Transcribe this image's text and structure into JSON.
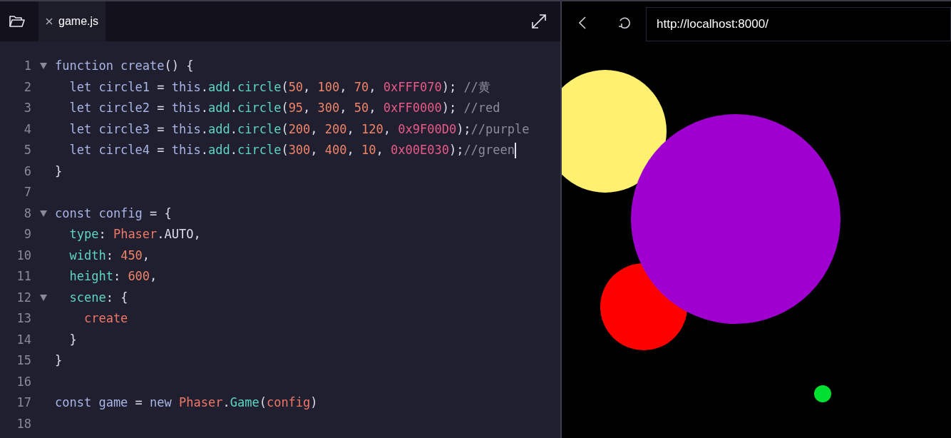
{
  "editor": {
    "tab": {
      "label": "game.js",
      "selected": true
    },
    "lines": [
      {
        "number": "1",
        "foldable": true,
        "cursor": false,
        "tokens": [
          {
            "kind": "keyword",
            "text": "function create"
          },
          {
            "kind": "plain",
            "text": "() {"
          }
        ]
      },
      {
        "number": "2",
        "foldable": false,
        "cursor": false,
        "tokens": [
          {
            "kind": "keyword",
            "text": "  let circle1 "
          },
          {
            "kind": "plain",
            "text": "= "
          },
          {
            "kind": "keyword",
            "text": "this"
          },
          {
            "kind": "plain",
            "text": "."
          },
          {
            "kind": "method",
            "text": "add"
          },
          {
            "kind": "plain",
            "text": "."
          },
          {
            "kind": "method",
            "text": "circle"
          },
          {
            "kind": "plain",
            "text": "("
          },
          {
            "kind": "number",
            "text": "50"
          },
          {
            "kind": "plain",
            "text": ", "
          },
          {
            "kind": "number",
            "text": "100"
          },
          {
            "kind": "plain",
            "text": ", "
          },
          {
            "kind": "number",
            "text": "70"
          },
          {
            "kind": "plain",
            "text": ", "
          },
          {
            "kind": "hex",
            "text": "0xFFF070"
          },
          {
            "kind": "plain",
            "text": "); "
          },
          {
            "kind": "comment",
            "text": "//黄"
          }
        ]
      },
      {
        "number": "3",
        "foldable": false,
        "cursor": false,
        "tokens": [
          {
            "kind": "keyword",
            "text": "  let circle2 "
          },
          {
            "kind": "plain",
            "text": "= "
          },
          {
            "kind": "keyword",
            "text": "this"
          },
          {
            "kind": "plain",
            "text": "."
          },
          {
            "kind": "method",
            "text": "add"
          },
          {
            "kind": "plain",
            "text": "."
          },
          {
            "kind": "method",
            "text": "circle"
          },
          {
            "kind": "plain",
            "text": "("
          },
          {
            "kind": "number",
            "text": "95"
          },
          {
            "kind": "plain",
            "text": ", "
          },
          {
            "kind": "number",
            "text": "300"
          },
          {
            "kind": "plain",
            "text": ", "
          },
          {
            "kind": "number",
            "text": "50"
          },
          {
            "kind": "plain",
            "text": ", "
          },
          {
            "kind": "hex",
            "text": "0xFF0000"
          },
          {
            "kind": "plain",
            "text": "); "
          },
          {
            "kind": "comment",
            "text": "//red"
          }
        ]
      },
      {
        "number": "4",
        "foldable": false,
        "cursor": false,
        "tokens": [
          {
            "kind": "keyword",
            "text": "  let circle3 "
          },
          {
            "kind": "plain",
            "text": "= "
          },
          {
            "kind": "keyword",
            "text": "this"
          },
          {
            "kind": "plain",
            "text": "."
          },
          {
            "kind": "method",
            "text": "add"
          },
          {
            "kind": "plain",
            "text": "."
          },
          {
            "kind": "method",
            "text": "circle"
          },
          {
            "kind": "plain",
            "text": "("
          },
          {
            "kind": "number",
            "text": "200"
          },
          {
            "kind": "plain",
            "text": ", "
          },
          {
            "kind": "number",
            "text": "200"
          },
          {
            "kind": "plain",
            "text": ", "
          },
          {
            "kind": "number",
            "text": "120"
          },
          {
            "kind": "plain",
            "text": ", "
          },
          {
            "kind": "hex",
            "text": "0x9F00D0"
          },
          {
            "kind": "plain",
            "text": ");"
          },
          {
            "kind": "comment",
            "text": "//purple"
          }
        ]
      },
      {
        "number": "5",
        "foldable": false,
        "cursor": true,
        "tokens": [
          {
            "kind": "keyword",
            "text": "  let circle4 "
          },
          {
            "kind": "plain",
            "text": "= "
          },
          {
            "kind": "keyword",
            "text": "this"
          },
          {
            "kind": "plain",
            "text": "."
          },
          {
            "kind": "method",
            "text": "add"
          },
          {
            "kind": "plain",
            "text": "."
          },
          {
            "kind": "method",
            "text": "circle"
          },
          {
            "kind": "plain",
            "text": "("
          },
          {
            "kind": "number",
            "text": "300"
          },
          {
            "kind": "plain",
            "text": ", "
          },
          {
            "kind": "number",
            "text": "400"
          },
          {
            "kind": "plain",
            "text": ", "
          },
          {
            "kind": "number",
            "text": "10"
          },
          {
            "kind": "plain",
            "text": ", "
          },
          {
            "kind": "hex",
            "text": "0x00E030"
          },
          {
            "kind": "plain",
            "text": ");"
          },
          {
            "kind": "comment",
            "text": "//green"
          }
        ]
      },
      {
        "number": "6",
        "foldable": false,
        "cursor": false,
        "tokens": [
          {
            "kind": "plain",
            "text": "}"
          }
        ]
      },
      {
        "number": "7",
        "foldable": false,
        "cursor": false
      },
      {
        "number": "8",
        "foldable": true,
        "cursor": false,
        "tokens": [
          {
            "kind": "keyword",
            "text": "const config "
          },
          {
            "kind": "plain",
            "text": "= {"
          }
        ]
      },
      {
        "number": "9",
        "foldable": false,
        "cursor": false,
        "tokens": [
          {
            "kind": "method",
            "text": "  type"
          },
          {
            "kind": "plain",
            "text": ": "
          },
          {
            "kind": "name",
            "text": "Phaser"
          },
          {
            "kind": "plain",
            "text": ".AUTO,"
          }
        ]
      },
      {
        "number": "10",
        "foldable": false,
        "cursor": false,
        "tokens": [
          {
            "kind": "method",
            "text": "  width"
          },
          {
            "kind": "plain",
            "text": ": "
          },
          {
            "kind": "number",
            "text": "450"
          },
          {
            "kind": "plain",
            "text": ","
          }
        ]
      },
      {
        "number": "11",
        "foldable": false,
        "cursor": false,
        "tokens": [
          {
            "kind": "method",
            "text": "  height"
          },
          {
            "kind": "plain",
            "text": ": "
          },
          {
            "kind": "number",
            "text": "600"
          },
          {
            "kind": "plain",
            "text": ","
          }
        ]
      },
      {
        "number": "12",
        "foldable": true,
        "cursor": false,
        "tokens": [
          {
            "kind": "method",
            "text": "  scene"
          },
          {
            "kind": "plain",
            "text": ": {"
          }
        ]
      },
      {
        "number": "13",
        "foldable": false,
        "cursor": false,
        "tokens": [
          {
            "kind": "name",
            "text": "    create"
          }
        ]
      },
      {
        "number": "14",
        "foldable": false,
        "cursor": false,
        "tokens": [
          {
            "kind": "plain",
            "text": "  }"
          }
        ]
      },
      {
        "number": "15",
        "foldable": false,
        "cursor": false,
        "tokens": [
          {
            "kind": "plain",
            "text": "}"
          }
        ]
      },
      {
        "number": "16",
        "foldable": false,
        "cursor": false
      },
      {
        "number": "17",
        "foldable": false,
        "cursor": false,
        "tokens": [
          {
            "kind": "keyword",
            "text": "const game "
          },
          {
            "kind": "plain",
            "text": "= "
          },
          {
            "kind": "keyword",
            "text": "new "
          },
          {
            "kind": "name",
            "text": "Phaser"
          },
          {
            "kind": "plain",
            "text": "."
          },
          {
            "kind": "method",
            "text": "Game"
          },
          {
            "kind": "plain",
            "text": "("
          },
          {
            "kind": "name",
            "text": "config"
          },
          {
            "kind": "plain",
            "text": ")"
          }
        ]
      },
      {
        "number": "18",
        "foldable": false,
        "cursor": false
      }
    ]
  },
  "browser": {
    "url": "http://localhost:8000/"
  }
}
